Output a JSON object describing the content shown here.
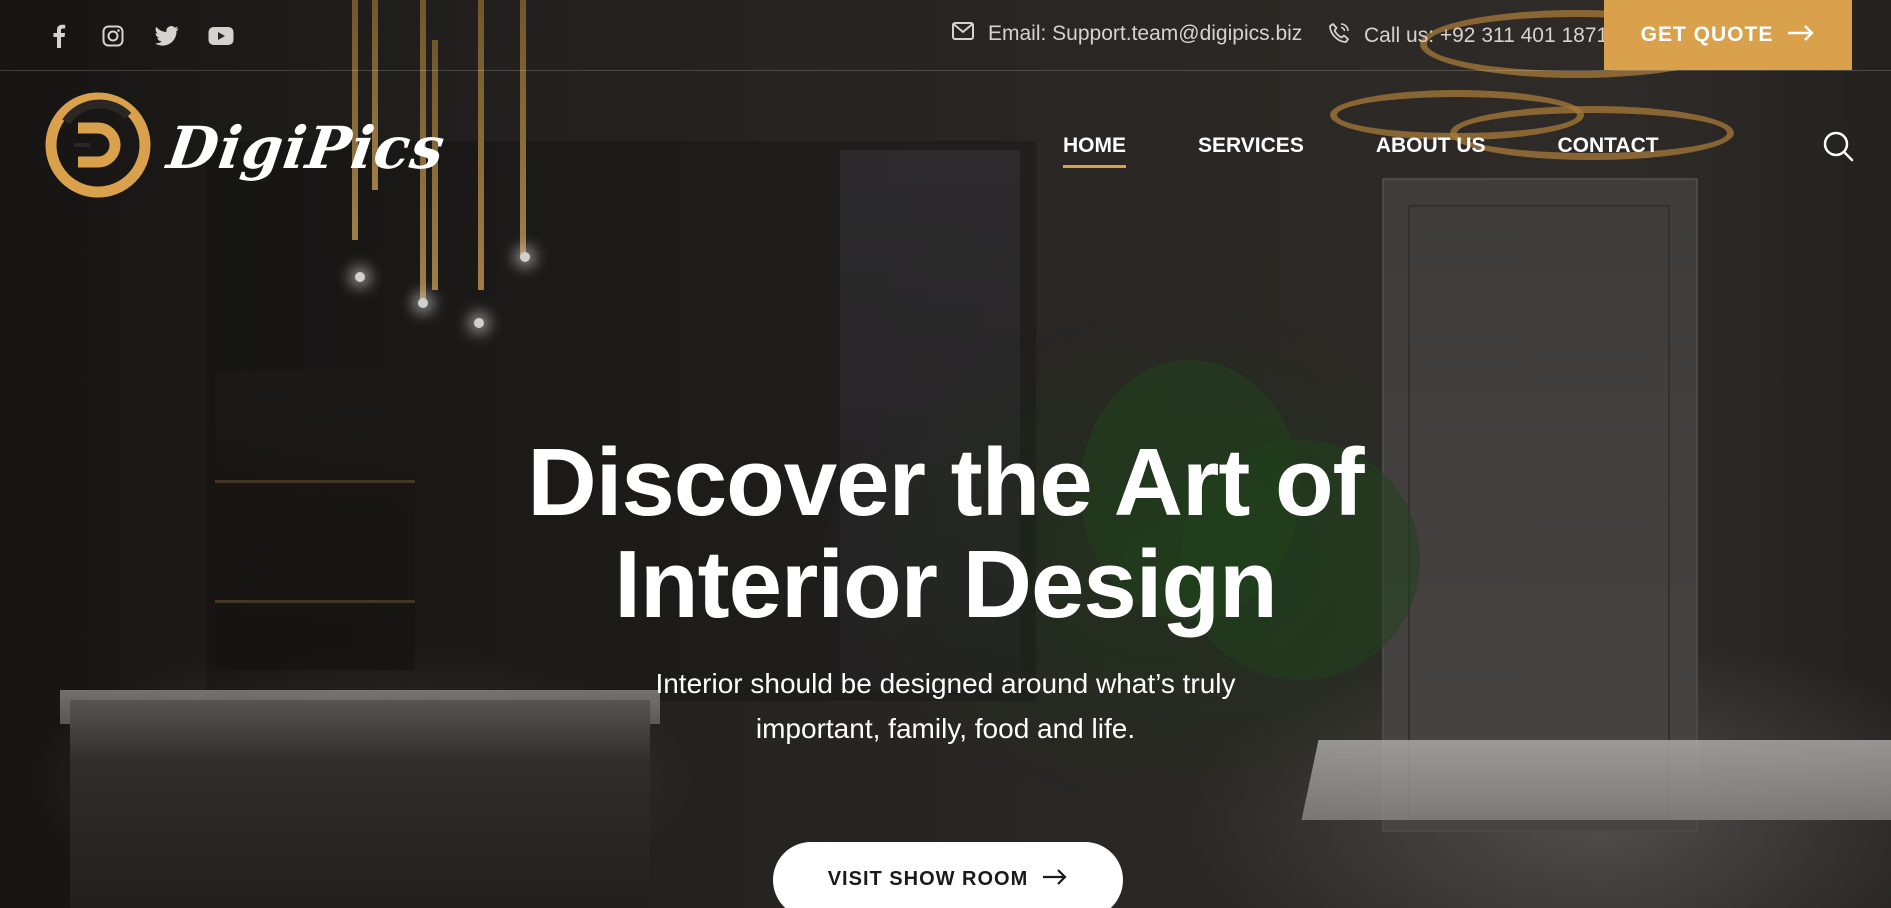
{
  "colors": {
    "accent": "#d9a14c",
    "text": "#ffffff"
  },
  "topbar": {
    "social": [
      {
        "name": "facebook-icon"
      },
      {
        "name": "instagram-icon"
      },
      {
        "name": "twitter-icon"
      },
      {
        "name": "youtube-icon"
      }
    ],
    "email_text": "Email: Support.team@digipics.biz",
    "phone_text": "Call us: +92 311 401 1871",
    "quote_button": "GET QUOTE"
  },
  "brand": {
    "name": "DigiPics"
  },
  "nav": {
    "items": [
      {
        "label": "HOME",
        "active": true
      },
      {
        "label": "SERVICES",
        "active": false
      },
      {
        "label": "ABOUT US",
        "active": false
      },
      {
        "label": "CONTACT",
        "active": false
      }
    ]
  },
  "hero": {
    "title_line1": "Discover the Art of",
    "title_line2": "Interior Design",
    "subtitle_line1": "Interior should be designed around what’s truly",
    "subtitle_line2": "important, family, food and life.",
    "cta": "VISIT SHOW ROOM"
  }
}
